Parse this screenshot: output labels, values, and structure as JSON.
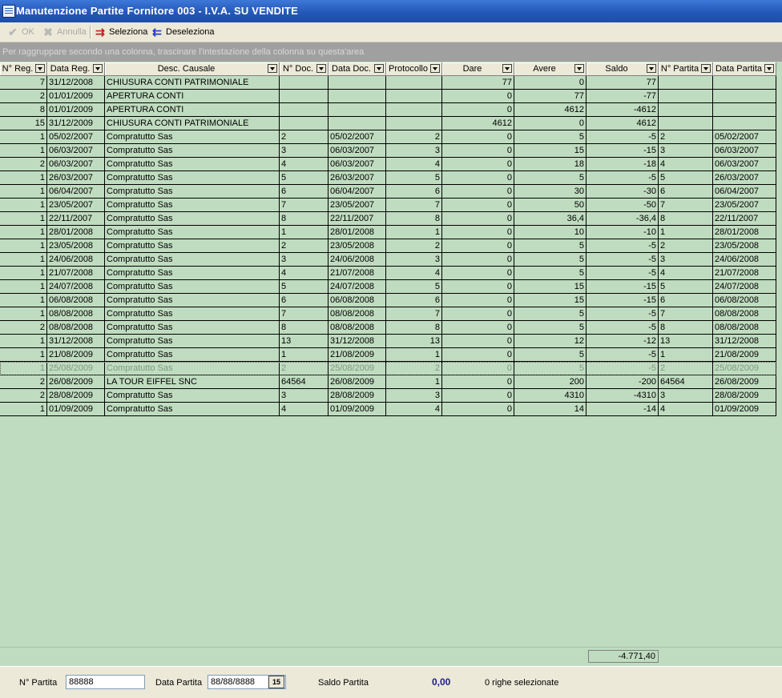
{
  "window": {
    "title": "Manutenzione Partite Fornitore  003 - I.V.A. SU VENDITE"
  },
  "toolbar": {
    "ok_label": "OK",
    "annulla_label": "Annulla",
    "seleziona_label": "Seleziona",
    "deseleziona_label": "Deseleziona"
  },
  "group_area": {
    "hint": "Per raggruppare secondo una colonna, trascinare l'intestazione della colonna su questa'area"
  },
  "grid": {
    "columns": [
      "N° Reg.",
      "Data Reg.",
      "Desc. Causale",
      "N° Doc.",
      "Data Doc.",
      "Protocollo",
      "Dare",
      "Avere",
      "Saldo",
      "N° Partita",
      "Data Partita"
    ],
    "rows": [
      [
        "7",
        "31/12/2008",
        "CHIUSURA CONTI PATRIMONIALE",
        "",
        "",
        "",
        "77",
        "0",
        "77",
        "",
        ""
      ],
      [
        "2",
        "01/01/2009",
        "APERTURA CONTI",
        "",
        "",
        "",
        "0",
        "77",
        "-77",
        "",
        ""
      ],
      [
        "8",
        "01/01/2009",
        "APERTURA CONTI",
        "",
        "",
        "",
        "0",
        "4612",
        "-4612",
        "",
        ""
      ],
      [
        "15",
        "31/12/2009",
        "CHIUSURA CONTI PATRIMONIALE",
        "",
        "",
        "",
        "4612",
        "0",
        "4612",
        "",
        ""
      ],
      [
        "1",
        "05/02/2007",
        "Compratutto Sas",
        "2",
        "05/02/2007",
        "2",
        "0",
        "5",
        "-5",
        "2",
        "05/02/2007"
      ],
      [
        "1",
        "06/03/2007",
        "Compratutto Sas",
        "3",
        "06/03/2007",
        "3",
        "0",
        "15",
        "-15",
        "3",
        "06/03/2007"
      ],
      [
        "2",
        "06/03/2007",
        "Compratutto Sas",
        "4",
        "06/03/2007",
        "4",
        "0",
        "18",
        "-18",
        "4",
        "06/03/2007"
      ],
      [
        "1",
        "26/03/2007",
        "Compratutto Sas",
        "5",
        "26/03/2007",
        "5",
        "0",
        "5",
        "-5",
        "5",
        "26/03/2007"
      ],
      [
        "1",
        "06/04/2007",
        "Compratutto Sas",
        "6",
        "06/04/2007",
        "6",
        "0",
        "30",
        "-30",
        "6",
        "06/04/2007"
      ],
      [
        "1",
        "23/05/2007",
        "Compratutto Sas",
        "7",
        "23/05/2007",
        "7",
        "0",
        "50",
        "-50",
        "7",
        "23/05/2007"
      ],
      [
        "1",
        "22/11/2007",
        "Compratutto Sas",
        "8",
        "22/11/2007",
        "8",
        "0",
        "36,4",
        "-36,4",
        "8",
        "22/11/2007"
      ],
      [
        "1",
        "28/01/2008",
        "Compratutto Sas",
        "1",
        "28/01/2008",
        "1",
        "0",
        "10",
        "-10",
        "1",
        "28/01/2008"
      ],
      [
        "1",
        "23/05/2008",
        "Compratutto Sas",
        "2",
        "23/05/2008",
        "2",
        "0",
        "5",
        "-5",
        "2",
        "23/05/2008"
      ],
      [
        "1",
        "24/06/2008",
        "Compratutto Sas",
        "3",
        "24/06/2008",
        "3",
        "0",
        "5",
        "-5",
        "3",
        "24/06/2008"
      ],
      [
        "1",
        "21/07/2008",
        "Compratutto Sas",
        "4",
        "21/07/2008",
        "4",
        "0",
        "5",
        "-5",
        "4",
        "21/07/2008"
      ],
      [
        "1",
        "24/07/2008",
        "Compratutto Sas",
        "5",
        "24/07/2008",
        "5",
        "0",
        "15",
        "-15",
        "5",
        "24/07/2008"
      ],
      [
        "1",
        "06/08/2008",
        "Compratutto Sas",
        "6",
        "06/08/2008",
        "6",
        "0",
        "15",
        "-15",
        "6",
        "06/08/2008"
      ],
      [
        "1",
        "08/08/2008",
        "Compratutto Sas",
        "7",
        "08/08/2008",
        "7",
        "0",
        "5",
        "-5",
        "7",
        "08/08/2008"
      ],
      [
        "2",
        "08/08/2008",
        "Compratutto Sas",
        "8",
        "08/08/2008",
        "8",
        "0",
        "5",
        "-5",
        "8",
        "08/08/2008"
      ],
      [
        "1",
        "31/12/2008",
        "Compratutto Sas",
        "13",
        "31/12/2008",
        "13",
        "0",
        "12",
        "-12",
        "13",
        "31/12/2008"
      ],
      [
        "1",
        "21/08/2009",
        "Compratutto Sas",
        "1",
        "21/08/2009",
        "1",
        "0",
        "5",
        "-5",
        "1",
        "21/08/2009"
      ],
      [
        "1",
        "25/08/2009",
        "Compratutto Sas",
        "2",
        "25/08/2009",
        "2",
        "0",
        "5",
        "-5",
        "2",
        "25/08/2009"
      ],
      [
        "2",
        "26/08/2009",
        "LA TOUR EIFFEL SNC",
        "64564",
        "26/08/2009",
        "1",
        "0",
        "200",
        "-200",
        "64564",
        "26/08/2009"
      ],
      [
        "2",
        "28/08/2009",
        "Compratutto Sas",
        "3",
        "28/08/2009",
        "3",
        "0",
        "4310",
        "-4310",
        "3",
        "28/08/2009"
      ],
      [
        "1",
        "01/09/2009",
        "Compratutto Sas",
        "4",
        "01/09/2009",
        "4",
        "0",
        "14",
        "-14",
        "4",
        "01/09/2009"
      ]
    ],
    "selected_row_index": 21
  },
  "totals": {
    "saldo_total": "-4.771,40"
  },
  "footer": {
    "npartita_label": "N° Partita",
    "npartita_value": "88888",
    "data_partita_label": "Data Partita",
    "data_partita_value": "88/88/8888",
    "calendar_button_label": "15",
    "saldo_partita_label": "Saldo Partita",
    "saldo_partita_value": "0,00",
    "selected_rows_text": "0 righe selezionate"
  }
}
